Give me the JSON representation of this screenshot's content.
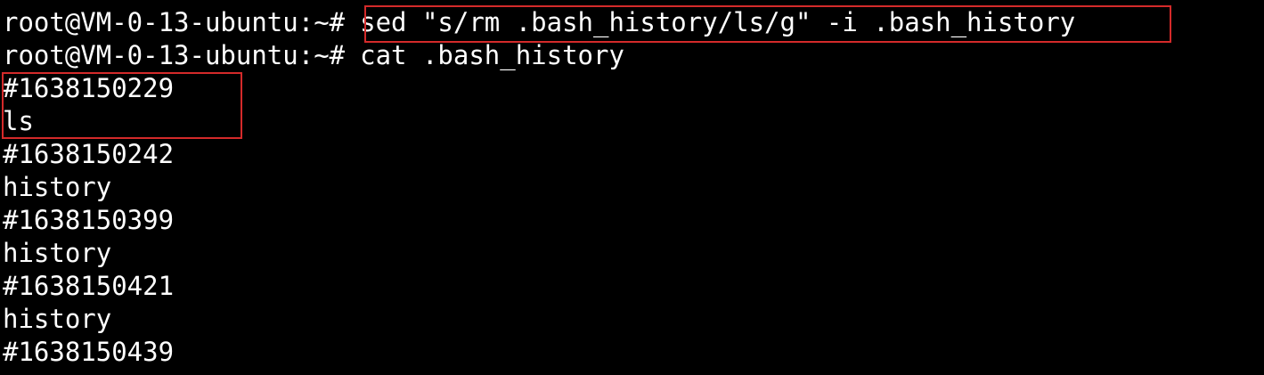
{
  "terminal": {
    "background": "#000000",
    "foreground": "#ffffff",
    "highlight_color": "#d42a2a",
    "prompt_1": "root@VM-0-13-ubuntu:~#",
    "command_1": "sed \"s/rm .bash_history/ls/g\" -i .bash_history",
    "prompt_2": "root@VM-0-13-ubuntu:~#",
    "command_2": "cat .bash_history",
    "output": [
      "#1638150229",
      "ls",
      "#1638150242",
      "history",
      "#1638150399",
      "history",
      "#1638150421",
      "history",
      "#1638150439"
    ]
  }
}
